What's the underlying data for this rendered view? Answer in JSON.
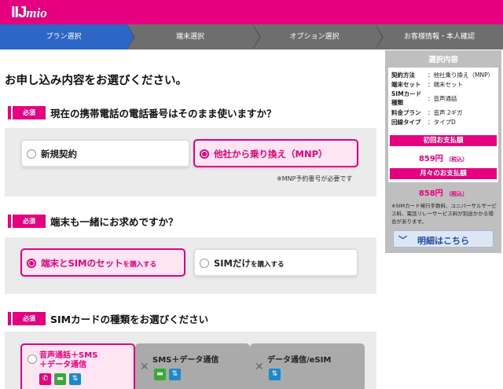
{
  "header": {
    "logo_main": "IIJ",
    "logo_sub": "mio",
    "color": "#e5007f"
  },
  "steps": [
    {
      "label": "プラン選択",
      "active": true
    },
    {
      "label": "端末選択",
      "active": false
    },
    {
      "label": "オプション選択",
      "active": false
    },
    {
      "label": "お客様情報・本人確認",
      "active": false
    }
  ],
  "page_title": "お申し込み内容をお選びください。",
  "required_badge": "必須",
  "q1": {
    "text": "現在の携帯電話の電話番号はそのまま使いますか？",
    "options": [
      {
        "label": "新規契約",
        "selected": false
      },
      {
        "label": "他社から乗り換え（MNP）",
        "selected": true
      }
    ],
    "note": "※MNP予約番号が必要です"
  },
  "q2": {
    "text": "端末も一緒にお求めですか？",
    "options": [
      {
        "label_main": "端末とSIMのセット",
        "label_suffix": "を購入する",
        "selected": true
      },
      {
        "label_main": "SIMだけ",
        "label_suffix": "を購入する",
        "selected": false
      }
    ]
  },
  "q3": {
    "text": "SIMカードの種類をお選びください",
    "cards": [
      {
        "title_line1": "音声通話＋SMS",
        "title_line2": "＋データ通信",
        "selected": true,
        "icons": [
          "phone-icon",
          "sms-icon",
          "data-icon"
        ]
      },
      {
        "title_line1": "SMS＋データ通信",
        "title_line2": "",
        "selected": false,
        "icons": [
          "sms-icon",
          "data-icon"
        ]
      },
      {
        "title_line1": "データ通信/eSIM",
        "title_line2": "",
        "selected": false,
        "icons": [
          "data-icon"
        ]
      }
    ]
  },
  "sidebar": {
    "title": "選択内容",
    "rows": [
      {
        "label": "契約方法",
        "value": "：他社乗り換え（MNP）"
      },
      {
        "label": "端末セット",
        "value": "：端末セット"
      },
      {
        "label": "SIMカード種類",
        "value": "：音声通話"
      },
      {
        "label": "料金プラン",
        "value": "：音声 2ギガ"
      },
      {
        "label": "回線タイプ",
        "value": "：タイプD"
      }
    ],
    "initial_label": "初回お支払額",
    "initial_amount": "859円",
    "initial_tax": "（税込）",
    "monthly_label": "月々のお支払額",
    "monthly_amount": "858円",
    "monthly_tax": "（税込）",
    "note": "※SIMカード発行手数料、ユニバーサルサービス料、電話リレーサービス料が別途かかる場合があります。",
    "detail_button": "明細はこちら"
  },
  "colors": {
    "brand": "#e5007f",
    "step_active": "#2d66c5",
    "link": "#1e4ca3",
    "icon_green": "#3aa935",
    "icon_blue": "#1e88c9"
  }
}
